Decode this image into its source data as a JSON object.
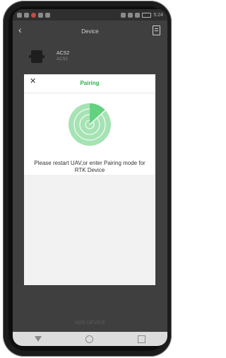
{
  "status": {
    "time": "5:24"
  },
  "header": {
    "title": "Device"
  },
  "device": {
    "name": "ACS2",
    "subtitle": "ACS2"
  },
  "modal": {
    "title": "Pairing",
    "message": "Please restart UAV,or enter Pairing mode for RTK Device"
  },
  "footer": {
    "add_device_label": "ADD DEVICE"
  },
  "colors": {
    "accent": "#2bb24c",
    "radar_fill": "#a6e3b4",
    "radar_ring": "#ffffff"
  }
}
